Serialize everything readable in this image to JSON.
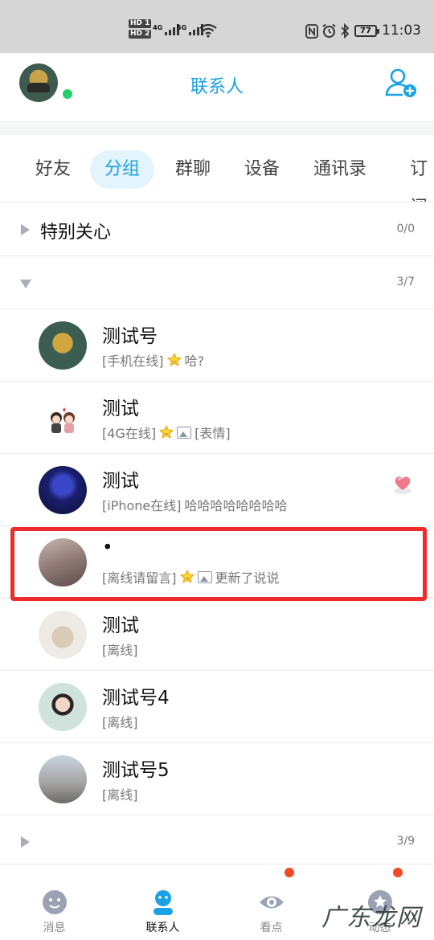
{
  "status_bar": {
    "hd1": "HD 1",
    "hd2": "HD 2",
    "net1": "4G",
    "net2": "5G",
    "battery": "77",
    "time": "11:03"
  },
  "header": {
    "title": "联系人"
  },
  "tabs": [
    "好友",
    "分组",
    "群聊",
    "设备",
    "通讯录",
    "订阅"
  ],
  "active_tab": "分组",
  "groups": {
    "special": {
      "name": "特别关心",
      "count": "0/0"
    },
    "second": {
      "name": "",
      "count": "3/7"
    },
    "third": {
      "name": "",
      "count": "3/9"
    }
  },
  "contacts": [
    {
      "name": "测试号",
      "status": "[手机在线]",
      "star": true,
      "has_image": false,
      "message": "哈?"
    },
    {
      "name": "测试",
      "status": "[4G在线]",
      "star": true,
      "has_image": true,
      "message": "[表情]"
    },
    {
      "name": "测试",
      "status": "[iPhone在线]",
      "star": false,
      "has_image": false,
      "message": "哈哈哈哈哈哈哈哈"
    },
    {
      "name": "•",
      "status": "[离线请留言]",
      "star": true,
      "has_image": true,
      "message": "更新了说说"
    },
    {
      "name": "测试",
      "status": "[离线]",
      "star": false,
      "has_image": false,
      "message": ""
    },
    {
      "name": "测试号4",
      "status": "[离线]",
      "star": false,
      "has_image": false,
      "message": ""
    },
    {
      "name": "测试号5",
      "status": "[离线]",
      "star": false,
      "has_image": false,
      "message": ""
    }
  ],
  "bottom_nav": [
    {
      "label": "消息"
    },
    {
      "label": "联系人"
    },
    {
      "label": "看点"
    },
    {
      "label": "动态"
    }
  ],
  "watermark": "广东龙网",
  "colors": {
    "accent": "#1aa1e6",
    "online": "#25d06c",
    "highlight": "#ee2b2b",
    "badge": "#f04b24"
  }
}
